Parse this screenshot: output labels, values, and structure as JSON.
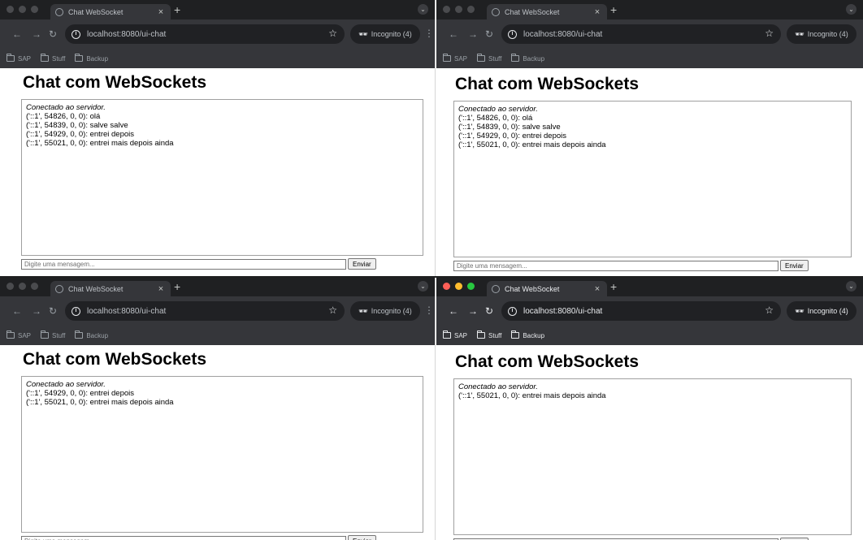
{
  "windows": [
    {
      "tab_title": "Chat WebSocket",
      "url": "localhost:8080/ui-chat",
      "incognito_label": "Incognito (4)",
      "bookmarks": [
        "SAP",
        "Stuff",
        "Backup"
      ],
      "page_title": "Chat com WebSockets",
      "messages": [
        "Conectado ao servidor.",
        "('::1', 54826, 0, 0): olá",
        "('::1', 54839, 0, 0): salve salve",
        "('::1', 54929, 0, 0): entrei depois",
        "('::1', 55021, 0, 0): entrei mais depois ainda"
      ],
      "input_placeholder": "Digite uma mensagem...",
      "send_label": "Enviar"
    },
    {
      "tab_title": "Chat WebSocket",
      "url": "localhost:8080/ui-chat",
      "incognito_label": "Incognito (4)",
      "bookmarks": [
        "SAP",
        "Stuff",
        "Backup"
      ],
      "page_title": "Chat com WebSockets",
      "messages": [
        "Conectado ao servidor.",
        "('::1', 54826, 0, 0): olá",
        "('::1', 54839, 0, 0): salve salve",
        "('::1', 54929, 0, 0): entrei depois",
        "('::1', 55021, 0, 0): entrei mais depois ainda"
      ],
      "input_placeholder": "Digite uma mensagem...",
      "send_label": "Enviar"
    },
    {
      "tab_title": "Chat WebSocket",
      "url": "localhost:8080/ui-chat",
      "incognito_label": "Incognito (4)",
      "bookmarks": [
        "SAP",
        "Stuff",
        "Backup"
      ],
      "page_title": "Chat com WebSockets",
      "messages": [
        "Conectado ao servidor.",
        "('::1', 54929, 0, 0): entrei depois",
        "('::1', 55021, 0, 0): entrei mais depois ainda"
      ],
      "input_placeholder": "Digite uma mensagem...",
      "send_label": "Enviar"
    },
    {
      "tab_title": "Chat WebSocket",
      "url": "localhost:8080/ui-chat",
      "incognito_label": "Incognito (4)",
      "bookmarks": [
        "SAP",
        "Stuff",
        "Backup"
      ],
      "page_title": "Chat com WebSockets",
      "messages": [
        "Conectado ao servidor.",
        "('::1', 55021, 0, 0): entrei mais depois ainda"
      ],
      "input_placeholder": "Digite uma mensagem...",
      "send_label": "Enviar"
    }
  ],
  "active_window": 3,
  "icons": {
    "back": "arrow-left-icon",
    "forward": "arrow-right-icon",
    "reload": "reload-icon",
    "site_info": "info-icon",
    "bookmark": "star-icon",
    "incognito": "incognito-icon",
    "menu": "kebab-menu-icon",
    "folder": "folder-icon",
    "tab_search": "chevron-down-icon"
  }
}
